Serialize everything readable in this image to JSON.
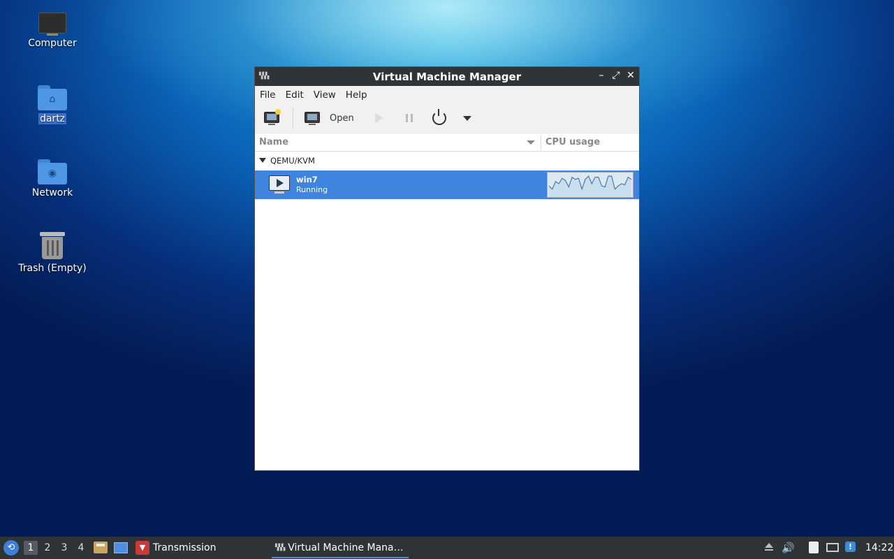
{
  "desktop": {
    "icons": [
      {
        "label": "Computer",
        "icon": "computer-icon"
      },
      {
        "label": "dartz",
        "icon": "home-folder-icon"
      },
      {
        "label": "Network",
        "icon": "network-folder-icon"
      },
      {
        "label": "Trash (Empty)",
        "icon": "trash-icon"
      }
    ]
  },
  "window": {
    "title": "Virtual Machine Manager",
    "controls": {
      "minimize": "–",
      "maximize": "⤢",
      "close": "✕"
    },
    "menu": [
      "File",
      "Edit",
      "View",
      "Help"
    ],
    "toolbar": {
      "new_vm_icon": "new-vm-icon",
      "open_label": "Open",
      "run_icon": "play-icon",
      "pause_icon": "pause-icon",
      "power_icon": "power-icon",
      "menu_icon": "dropdown-arrow-icon"
    },
    "columns": {
      "name": "Name",
      "cpu": "CPU usage"
    },
    "group": "QEMU/KVM",
    "vms": [
      {
        "name": "win7",
        "status": "Running",
        "cpu_history": [
          0.45,
          0.3,
          0.65,
          0.55,
          0.8,
          0.7,
          0.4,
          0.85,
          0.75,
          0.8,
          0.3,
          0.75,
          0.9,
          0.55,
          0.85,
          0.85,
          0.45,
          0.4,
          0.9,
          0.9,
          0.3,
          0.45,
          0.55,
          0.5,
          0.85,
          0.75
        ]
      }
    ]
  },
  "taskbar": {
    "workspaces": [
      "1",
      "2",
      "3",
      "4"
    ],
    "active_workspace": "1",
    "tasks": [
      {
        "label": "Transmission",
        "icon": "transmission-icon"
      },
      {
        "label": "Virtual Machine Mana…",
        "icon": "virt-manager-icon"
      }
    ],
    "clock": "14:22"
  }
}
